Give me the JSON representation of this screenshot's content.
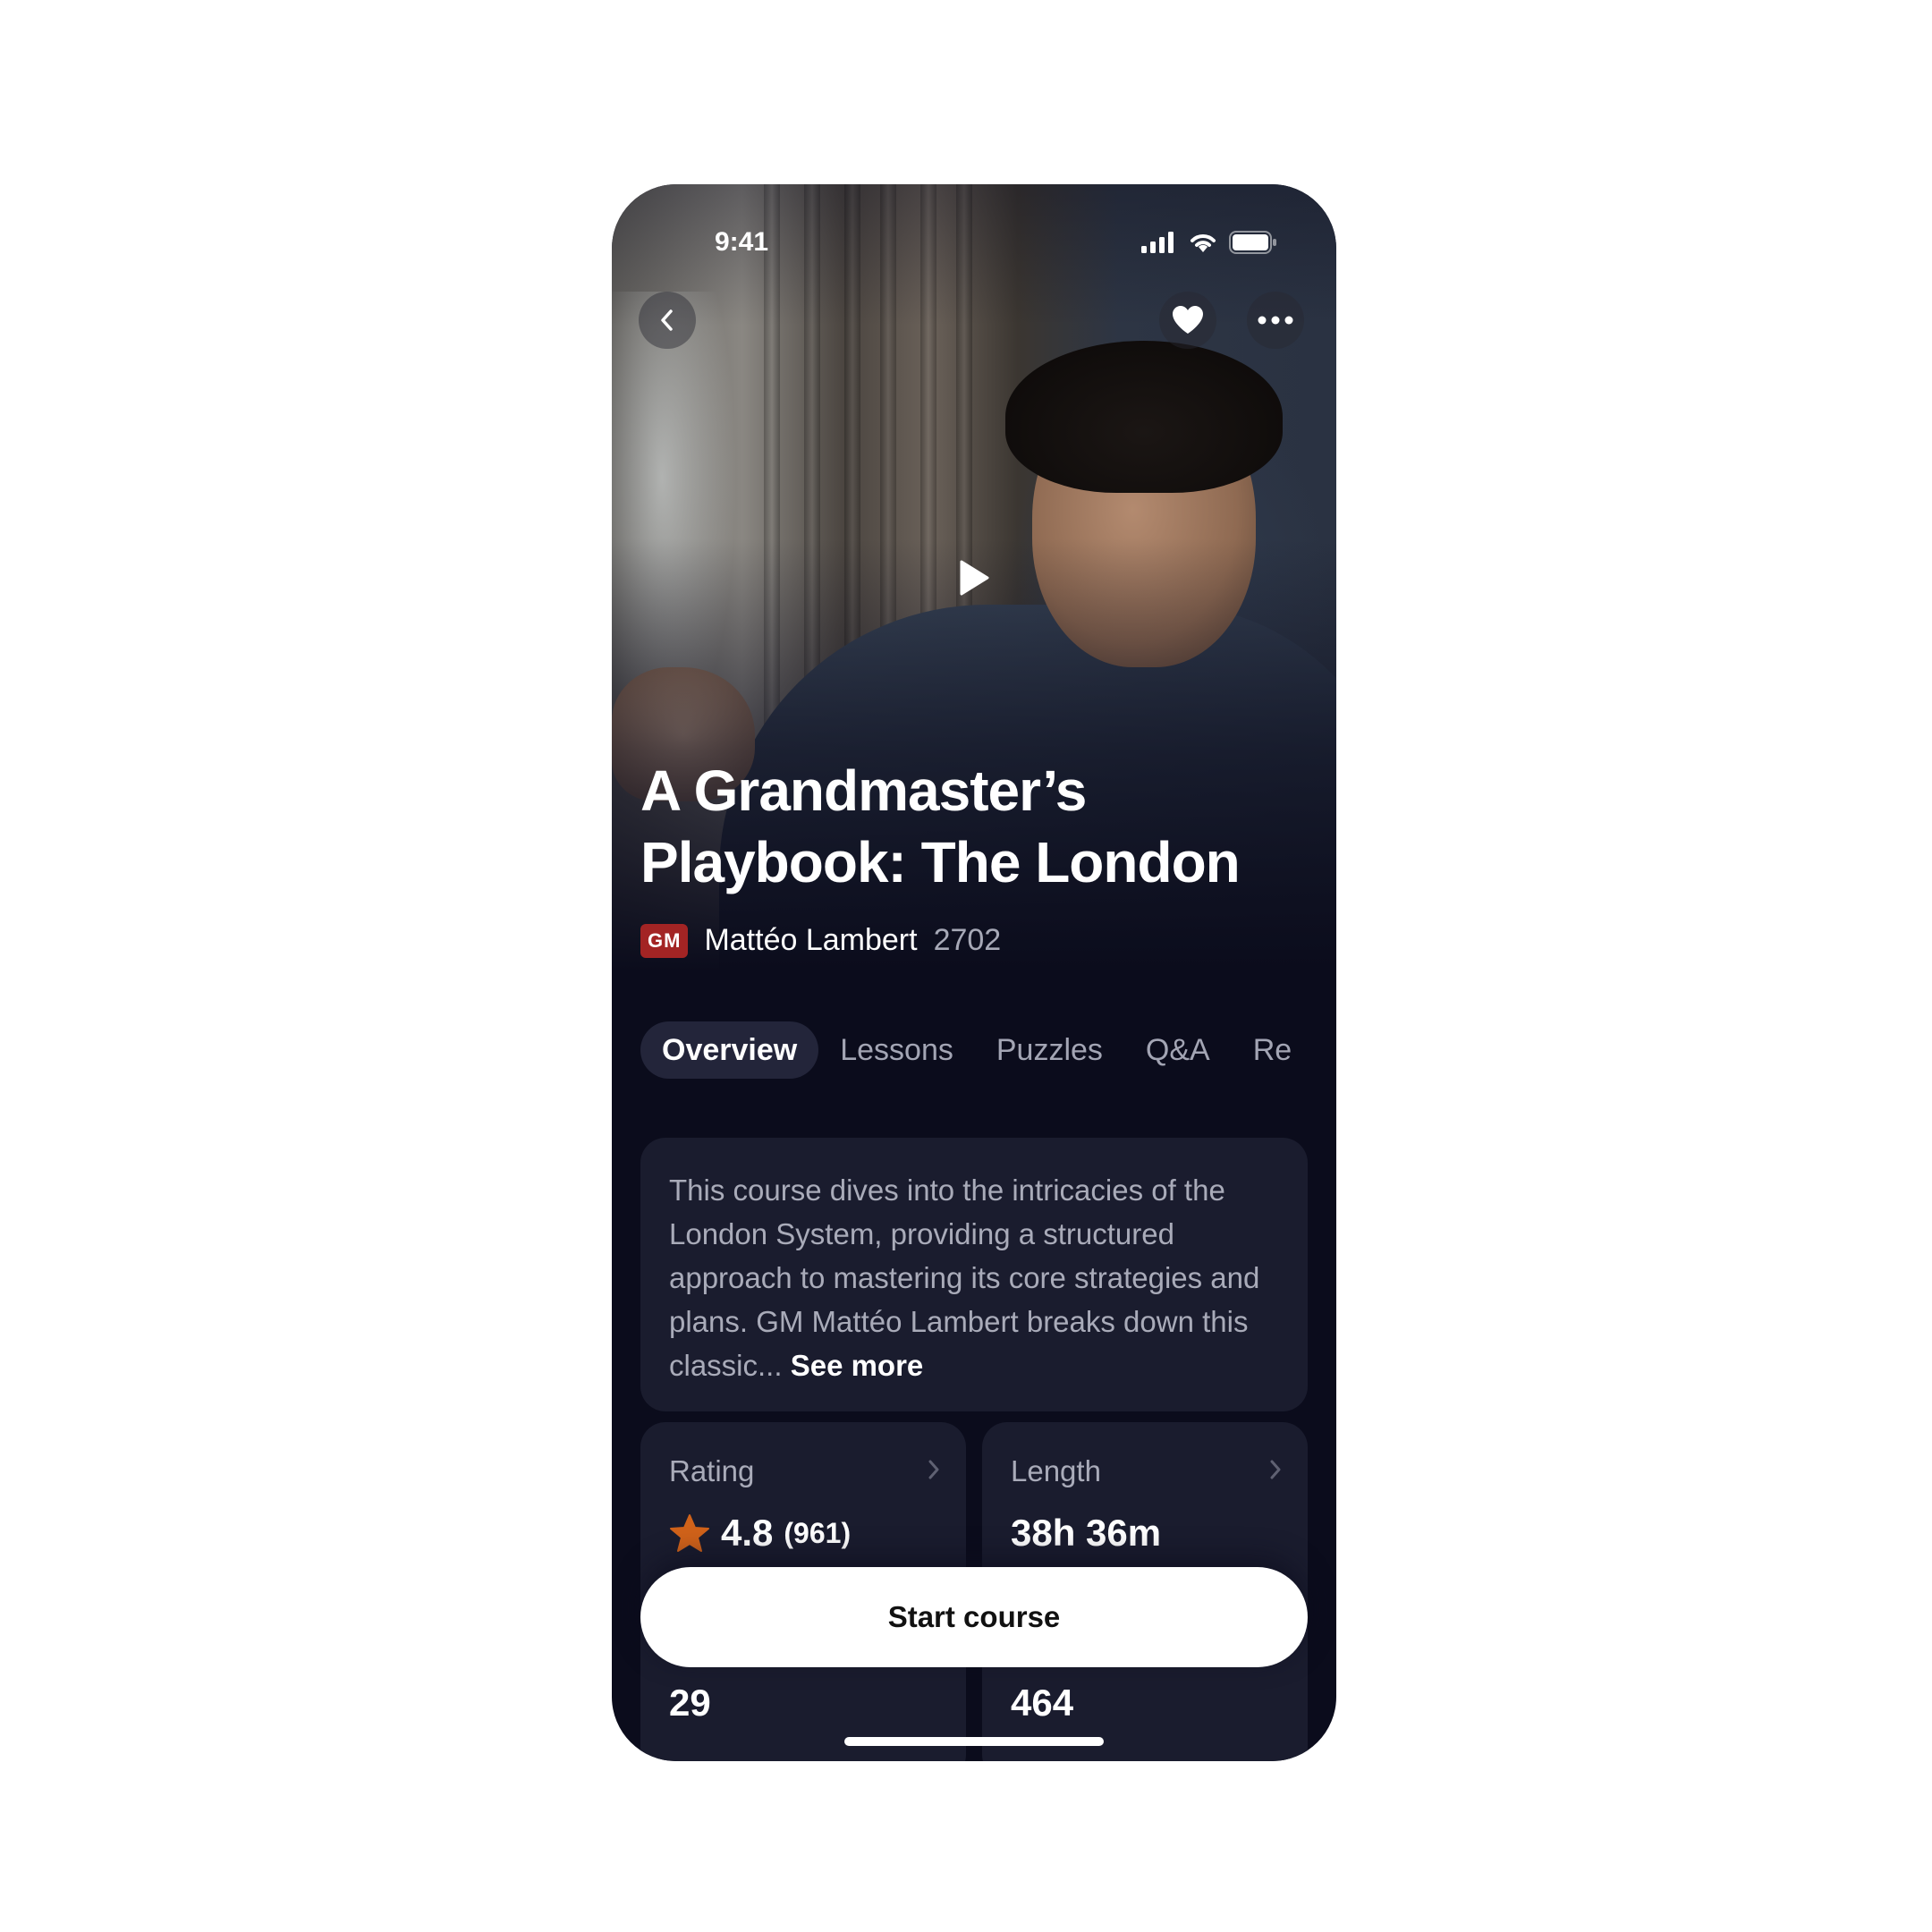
{
  "status_bar": {
    "time": "9:41"
  },
  "hero": {
    "title_line1": "A Grandmaster’s",
    "title_line2": "Playbook: The London"
  },
  "author": {
    "badge": "GM",
    "name": "Mattéo Lambert",
    "rating": "2702"
  },
  "tabs": [
    {
      "label": "Overview",
      "active": true
    },
    {
      "label": "Lessons",
      "active": false
    },
    {
      "label": "Puzzles",
      "active": false
    },
    {
      "label": "Q&A",
      "active": false
    },
    {
      "label": "Re",
      "active": false
    }
  ],
  "description": {
    "text": "This course dives into the intricacies of the London System, providing a structured approach to mastering its core strategies and plans. GM Mattéo Lambert breaks down this classic...",
    "see_more": "See more"
  },
  "stats": {
    "rating": {
      "label": "Rating",
      "value": "4.8",
      "count": "(961)"
    },
    "length": {
      "label": "Length",
      "value": "38h 36m"
    },
    "lower_left_value": "29",
    "lower_right_value": "464"
  },
  "cta": {
    "label": "Start course"
  },
  "colors": {
    "background": "#0b0c1c",
    "card": "#1a1c2e",
    "gm_badge": "#a32424",
    "star": "#d0621a"
  },
  "icons": {
    "back": "chevron-left-icon",
    "favorite": "heart-icon",
    "more": "more-horizontal-icon",
    "play": "play-icon",
    "star": "star-icon"
  }
}
